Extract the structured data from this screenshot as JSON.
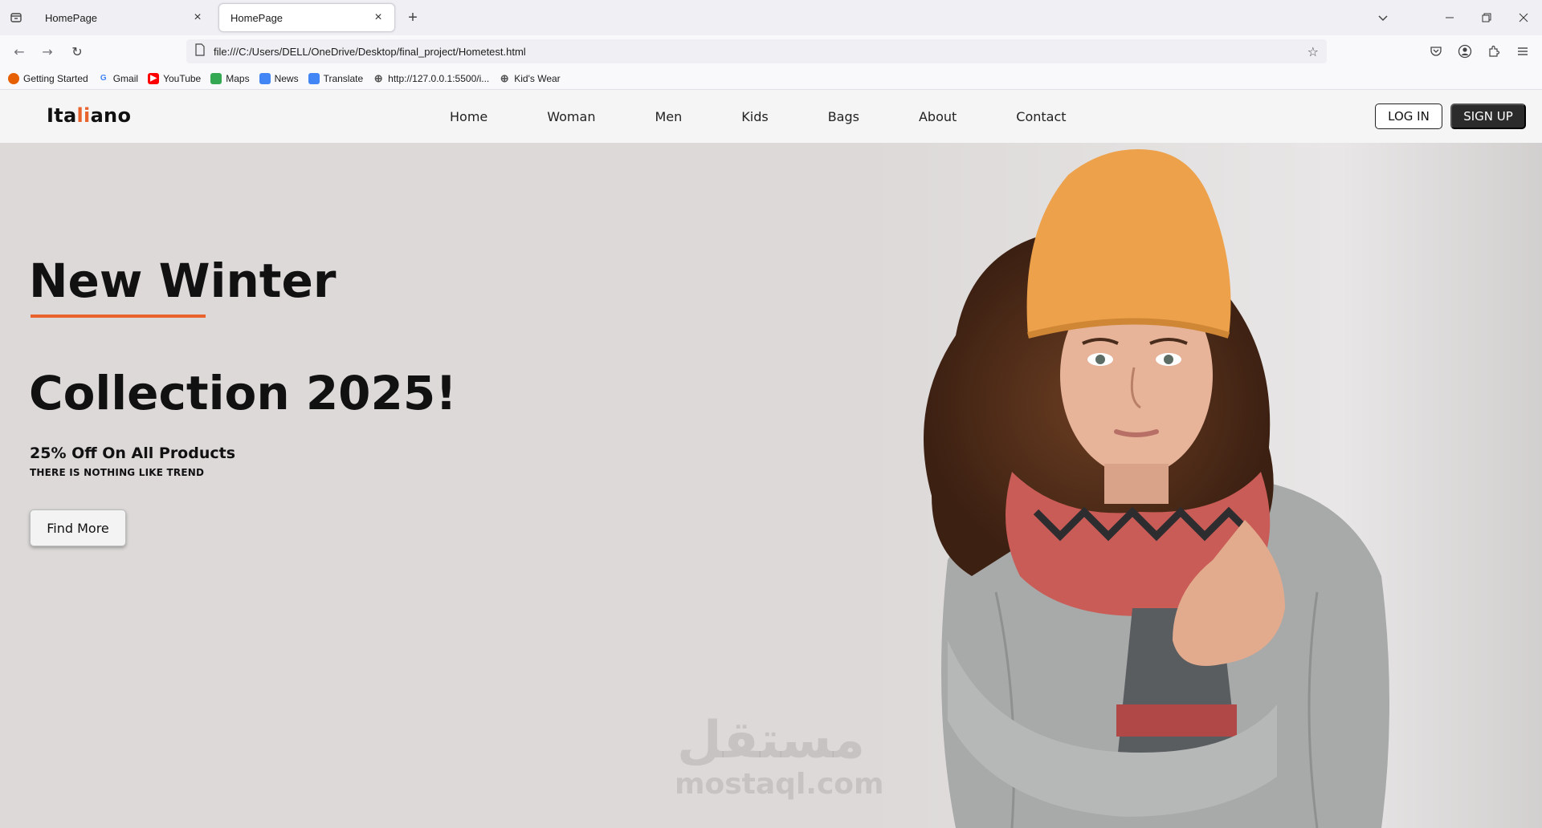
{
  "browser": {
    "tabs": [
      {
        "title": "HomePage"
      },
      {
        "title": "HomePage"
      }
    ],
    "url": "file:///C:/Users/DELL/OneDrive/Desktop/final_project/Hometest.html",
    "bookmarks": [
      {
        "label": "Getting Started",
        "icon": "firefox-icon",
        "color": "#e66000"
      },
      {
        "label": "Gmail",
        "icon": "google-icon",
        "color": "#4285f4"
      },
      {
        "label": "YouTube",
        "icon": "youtube-icon",
        "color": "#ff0000"
      },
      {
        "label": "Maps",
        "icon": "maps-icon",
        "color": "#34a853"
      },
      {
        "label": "News",
        "icon": "news-icon",
        "color": "#4285f4"
      },
      {
        "label": "Translate",
        "icon": "translate-icon",
        "color": "#4285f4"
      },
      {
        "label": "http://127.0.0.1:5500/i...",
        "icon": "globe-icon",
        "color": "#555555"
      },
      {
        "label": "Kid's Wear",
        "icon": "globe-icon",
        "color": "#555555"
      }
    ]
  },
  "site": {
    "logo": {
      "part1": "Ita",
      "part2": "li",
      "part3": "ano"
    },
    "nav": [
      "Home",
      "Woman",
      "Men",
      "Kids",
      "Bags",
      "About",
      "Contact"
    ],
    "login_label": "LOG IN",
    "signup_label": "SIGN UP",
    "accent_color": "#e8642c",
    "hero": {
      "title_line1": "New Winter",
      "title_line2": "Collection 2025!",
      "offer": "25% Off On All Products",
      "tagline": "THERE IS NOTHING LIKE TREND",
      "cta": "Find More"
    },
    "watermark": {
      "arabic": "مستقل",
      "latin": "mostaql.com"
    }
  }
}
